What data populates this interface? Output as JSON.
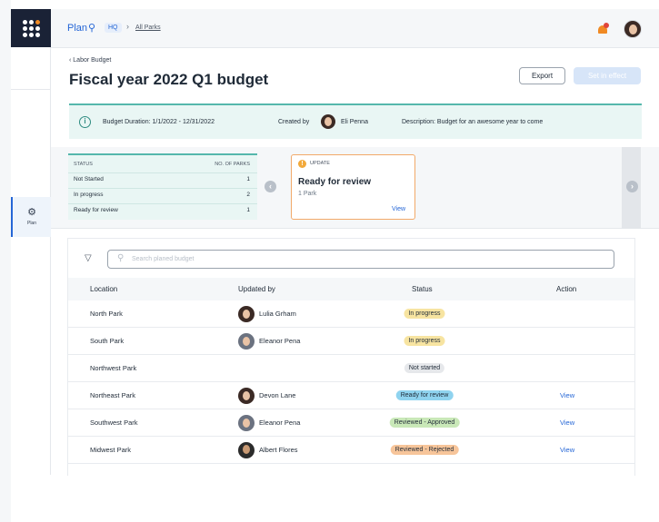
{
  "topbar": {
    "plan_label": "Plan",
    "hq_tag": "HQ",
    "breadcrumb": "All Parks",
    "notification_color": "#f08a24"
  },
  "sidebar": {
    "items": [
      {
        "label": "Plan",
        "icon": "gear-icon",
        "active": true
      }
    ]
  },
  "header": {
    "back_label": "Labor Budget",
    "title": "Fiscal year 2022 Q1 budget",
    "export_label": "Export",
    "set_in_effect_label": "Set in effect"
  },
  "info": {
    "duration": "Budget Duration: 1/1/2022 - 12/31/2022",
    "created_by_label": "Created by",
    "created_by_name": "Eli Penna",
    "description": "Description: Budget for an awesome year to come"
  },
  "status_summary": {
    "headers": [
      "STATUS",
      "NO. OF PARKS"
    ],
    "rows": [
      {
        "status": "Not Started",
        "count": "1"
      },
      {
        "status": "In progress",
        "count": "2"
      },
      {
        "status": "Ready for review",
        "count": "1"
      }
    ]
  },
  "update_card": {
    "tag": "UPDATE",
    "title": "Ready for review",
    "subtitle": "1 Park",
    "link": "View"
  },
  "table": {
    "search_placeholder": "Search planed budget",
    "columns": [
      "Location",
      "Updated by",
      "Status",
      "Action"
    ],
    "rows": [
      {
        "location": "North Park",
        "updated_by": "Lulia Grham",
        "status": "In progress",
        "status_color": "#f7e4a1",
        "action": ""
      },
      {
        "location": "South Park",
        "updated_by": "Eleanor Pena",
        "status": "In progress",
        "status_color": "#f7e4a1",
        "action": ""
      },
      {
        "location": "Northwest Park",
        "updated_by": "",
        "status": "Not started",
        "status_color": "#e6e8eb",
        "action": ""
      },
      {
        "location": "Northeast Park",
        "updated_by": "Devon Lane",
        "status": "Ready for review",
        "status_color": "#8fd3ef",
        "action": "View"
      },
      {
        "location": "Southwest Park",
        "updated_by": "Eleanor Pena",
        "status": "Reviewed - Approved",
        "status_color": "#c9e8b8",
        "action": "View"
      },
      {
        "location": "Midwest Park",
        "updated_by": "Albert Flores",
        "status": "Reviewed - Rejected",
        "status_color": "#f7c59a",
        "action": "View"
      }
    ]
  },
  "colors": {
    "accent": "#2566d6",
    "teal": "#55b7ac",
    "orange": "#f08a24"
  }
}
